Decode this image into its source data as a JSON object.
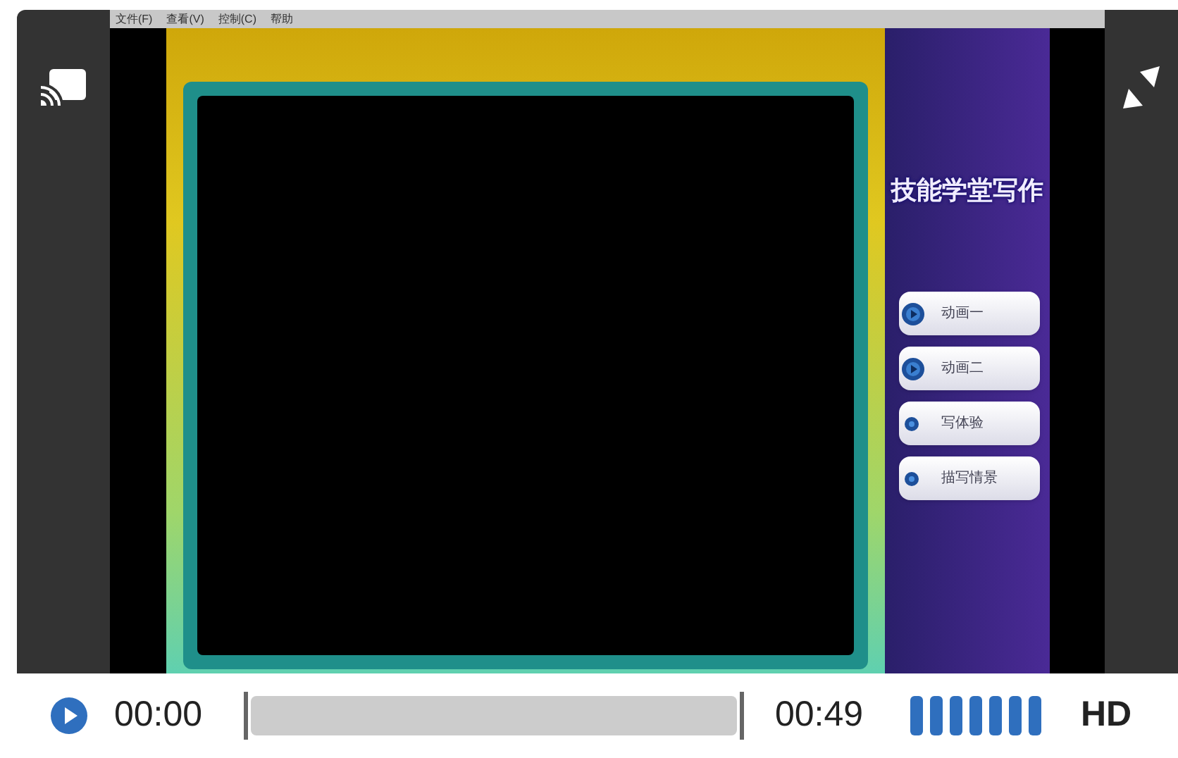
{
  "menu_bar": [
    "文件(F)",
    "查看(V)",
    "控制(C)",
    "帮助"
  ],
  "lesson_title": "技能学堂写作",
  "lesson_buttons": [
    {
      "label": "动画一",
      "kind": "play"
    },
    {
      "label": "动画二",
      "kind": "play"
    },
    {
      "label": "写体验",
      "kind": "dot"
    },
    {
      "label": "描写情景",
      "kind": "dot"
    }
  ],
  "controls": {
    "elapsed": "00:00",
    "progress": {
      "level": 0
    },
    "duration": "00:49",
    "volume": {
      "level": 1
    },
    "quality": "HD"
  }
}
